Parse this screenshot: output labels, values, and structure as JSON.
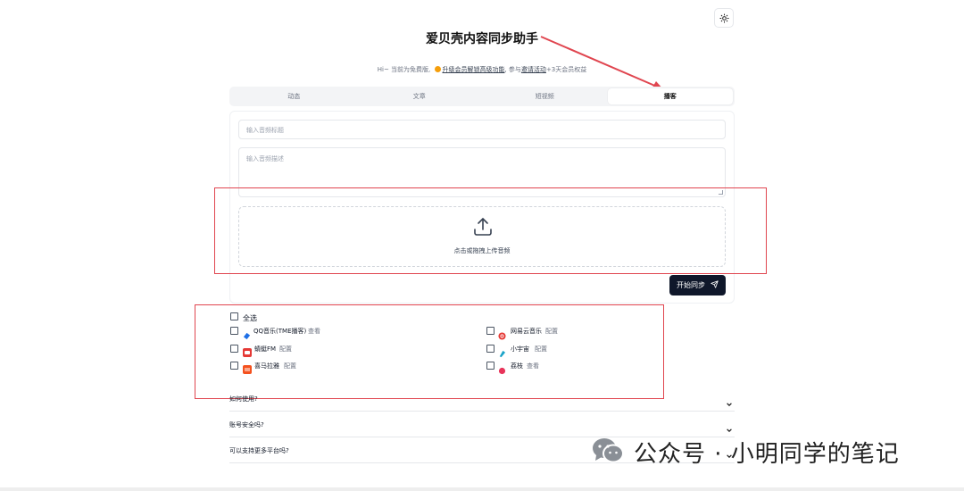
{
  "header": {
    "title": "爱贝壳内容同步助手",
    "subtitle": {
      "prefix": "Hi~ 当前为免费版, ",
      "upgrade_link": "升级会员解锁高级功能",
      "middle": ", 参与",
      "invite_link": "邀请活动",
      "suffix": "+3天会员权益"
    }
  },
  "tabs": [
    {
      "label": "动态",
      "active": false
    },
    {
      "label": "文章",
      "active": false
    },
    {
      "label": "短视频",
      "active": false
    },
    {
      "label": "播客",
      "active": true
    }
  ],
  "form": {
    "title_placeholder": "输入音频标题",
    "desc_placeholder": "输入音频描述",
    "upload_text": "点击或拖拽上传音频",
    "submit_label": "开始同步"
  },
  "platforms": {
    "select_all_label": "全选",
    "items": [
      {
        "name": "QQ音乐(TME播客)",
        "action": "查看",
        "color": "#1e6fe6"
      },
      {
        "name": "网易云音乐",
        "action": "配置",
        "color": "#e53935"
      },
      {
        "name": "蜻蜓FM",
        "action": "配置",
        "color": "#e53935"
      },
      {
        "name": "小宇宙",
        "action": "配置",
        "color": "#1aa3c8"
      },
      {
        "name": "喜马拉雅",
        "action": "配置",
        "color": "#f4511e"
      },
      {
        "name": "荔枝",
        "action": "查看",
        "color": "#e8345a"
      }
    ]
  },
  "faq": [
    {
      "question": "如何使用?"
    },
    {
      "question": "账号安全吗?"
    },
    {
      "question": "可以支持更多平台吗?"
    }
  ],
  "watermark": {
    "text": "公众号 · 小明同学的笔记"
  },
  "annotation_color": "#e0454f"
}
